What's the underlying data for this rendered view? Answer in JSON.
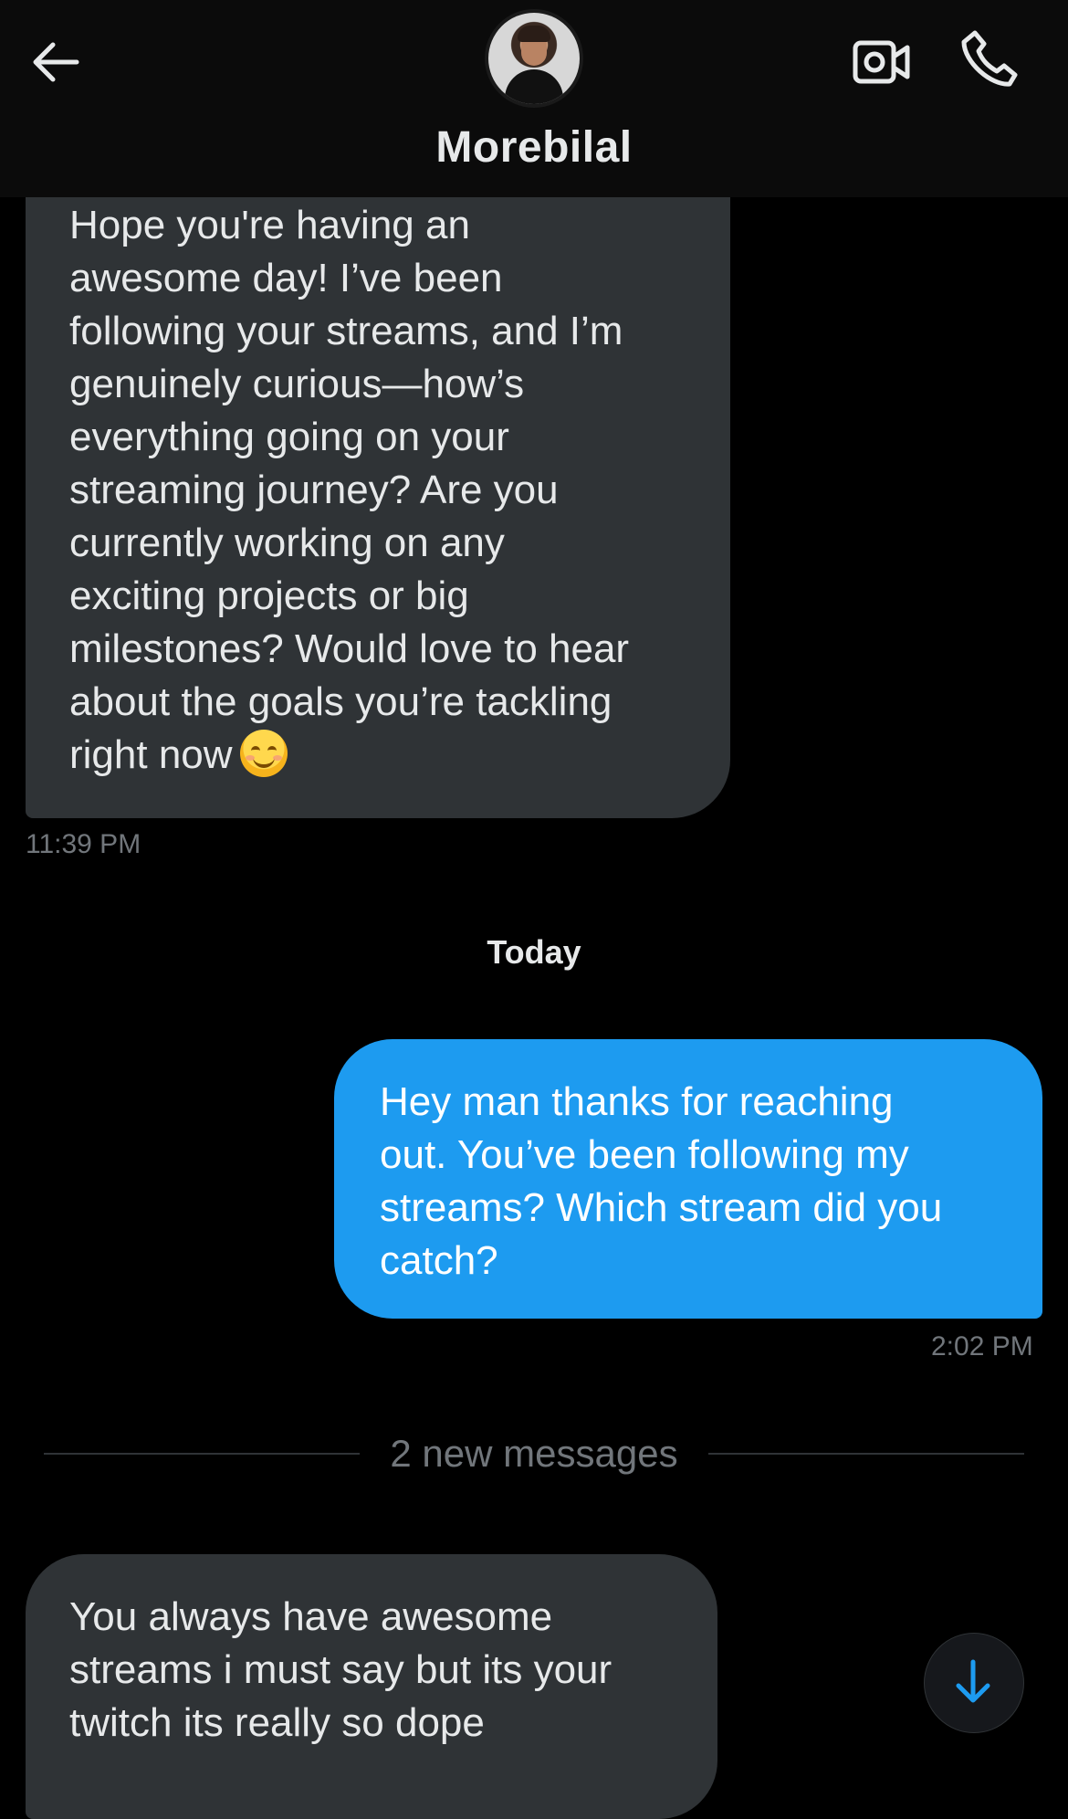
{
  "header": {
    "contact_name": "Morebilal",
    "icons": {
      "back": "arrow-left-icon",
      "video": "video-camera-icon",
      "call": "phone-icon"
    }
  },
  "messages": [
    {
      "direction": "incoming",
      "lines": [
        "Hope you're having an",
        "awesome day! I’ve been",
        "following your streams, and I’m",
        "genuinely curious—how’s",
        "everything going on your",
        "streaming journey? Are you",
        "currently working on any",
        "exciting projects or big",
        "milestones? Would love to hear",
        "about the goals you’re tackling",
        "right now"
      ],
      "emoji": "smiling-face-emoji",
      "time": "11:39 PM"
    },
    {
      "direction": "outgoing",
      "lines": [
        "Hey man thanks for reaching",
        "out. You’ve been following my",
        "streams? Which stream did you",
        "catch?"
      ],
      "time": "2:02 PM"
    },
    {
      "direction": "incoming",
      "lines": [
        "You always have awesome",
        "streams i must say but its your",
        "twitch its really so dope"
      ]
    }
  ],
  "day_divider": "Today",
  "new_messages_label": "2 new messages",
  "colors": {
    "background": "#000000",
    "incoming_bubble": "#2f3336",
    "outgoing_bubble": "#1d9bf0",
    "muted_text": "#71767b"
  }
}
